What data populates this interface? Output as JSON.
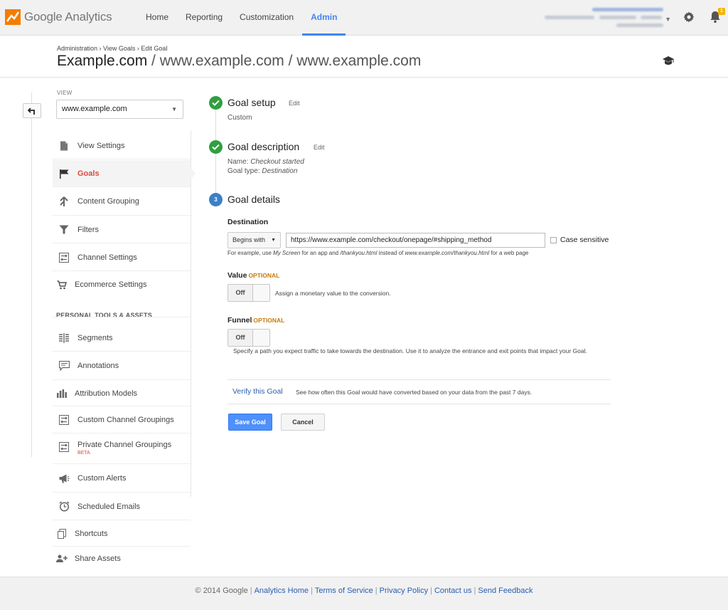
{
  "app": {
    "logo_text": "Google Analytics"
  },
  "nav": {
    "items": [
      "Home",
      "Reporting",
      "Customization",
      "Admin"
    ],
    "active": "Admin"
  },
  "notifications": {
    "badge_count": "1"
  },
  "header": {
    "breadcrumb": [
      "Administration",
      "View Goals",
      "Edit Goal"
    ],
    "title_main": "Example.com",
    "title_rest": " / www.example.com / www.example.com"
  },
  "sidebar": {
    "view_label": "VIEW",
    "view_value": "www.example.com",
    "items": [
      {
        "label": "View Settings",
        "icon": "document-icon"
      },
      {
        "label": "Goals",
        "icon": "flag-icon",
        "active": true
      },
      {
        "label": "Content Grouping",
        "icon": "content-grouping-icon"
      },
      {
        "label": "Filters",
        "icon": "filter-icon"
      },
      {
        "label": "Channel Settings",
        "icon": "channel-settings-icon"
      },
      {
        "label": "Ecommerce Settings",
        "icon": "cart-icon"
      }
    ],
    "section_label": "PERSONAL TOOLS & ASSETS",
    "tools": [
      {
        "label": "Segments",
        "icon": "segments-icon"
      },
      {
        "label": "Annotations",
        "icon": "annotation-icon"
      },
      {
        "label": "Attribution Models",
        "icon": "bar-chart-icon"
      },
      {
        "label": "Custom Channel Groupings",
        "icon": "channel-grouping-icon"
      },
      {
        "label": "Private Channel Groupings",
        "icon": "channel-grouping-icon",
        "badge": "BETA"
      },
      {
        "label": "Custom Alerts",
        "icon": "megaphone-icon"
      },
      {
        "label": "Scheduled Emails",
        "icon": "clock-icon"
      },
      {
        "label": "Shortcuts",
        "icon": "shortcut-icon"
      },
      {
        "label": "Share Assets",
        "icon": "share-icon"
      }
    ]
  },
  "steps": {
    "setup": {
      "title": "Goal setup",
      "edit": "Edit",
      "sub": "Custom"
    },
    "description": {
      "title": "Goal description",
      "edit": "Edit",
      "name_label": "Name: ",
      "name_value": "Checkout started",
      "type_label": "Goal type: ",
      "type_value": "Destination"
    },
    "details": {
      "number": "3",
      "title": "Goal details"
    }
  },
  "destination": {
    "label": "Destination",
    "match_type": "Begins with",
    "value": "https://www.example.com/checkout/onepage/#shipping_method",
    "case_sensitive_label": "Case sensitive",
    "hint_1": "For example, use ",
    "hint_2": "My Screen",
    "hint_3": " for an app and ",
    "hint_4": "/thankyou.html",
    "hint_5": " instead of ",
    "hint_6": "www.example.com/thankyou.html",
    "hint_7": " for a web page"
  },
  "value": {
    "label": "Value",
    "optional": "OPTIONAL",
    "toggle": "Off",
    "desc": "Assign a monetary value to the conversion."
  },
  "funnel": {
    "label": "Funnel",
    "optional": "OPTIONAL",
    "toggle": "Off",
    "desc": "Specify a path you expect traffic to take towards the destination. Use it to analyze the entrance and exit points that impact your Goal."
  },
  "verify": {
    "link": "Verify this Goal",
    "desc": "See how often this Goal would have converted based on your data from the past 7 days."
  },
  "actions": {
    "save": "Save Goal",
    "cancel": "Cancel"
  },
  "footer": {
    "copyright": "© 2014 Google",
    "links": [
      "Analytics Home",
      "Terms of Service",
      "Privacy Policy",
      "Contact us",
      "Send Feedback"
    ]
  },
  "colors": {
    "accent": "#4285f4",
    "active_item": "#dd4b39",
    "done_step": "#2f9f3f",
    "current_step": "#3a80c7",
    "optional": "#c77c0e"
  }
}
